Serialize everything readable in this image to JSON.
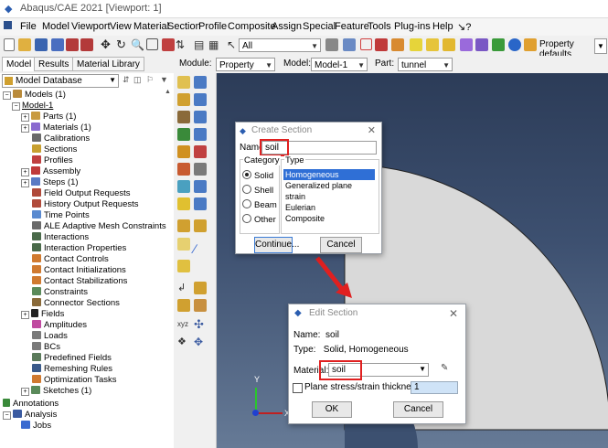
{
  "window": {
    "title": "Abaqus/CAE 2021 [Viewport: 1]"
  },
  "menu": [
    "File",
    "Model",
    "Viewport",
    "View",
    "Material",
    "Section",
    "Profile",
    "Composite",
    "Assign",
    "Special",
    "Feature",
    "Tools",
    "Plug-ins",
    "Help",
    "↘?"
  ],
  "toolbar": {
    "select_filter": "All",
    "property_defaults": "Property defaults"
  },
  "tabs": [
    "Model",
    "Results",
    "Material Library"
  ],
  "context": {
    "module_label": "Module:",
    "module": "Property",
    "model_label": "Model:",
    "model": "Model-1",
    "part_label": "Part:",
    "part": "tunnel"
  },
  "tree": {
    "header": "Model Database",
    "items": [
      "Models (1)",
      "Model-1",
      "Parts (1)",
      "Materials (1)",
      "Calibrations",
      "Sections",
      "Profiles",
      "Assembly",
      "Steps (1)",
      "Field Output Requests",
      "History Output Requests",
      "Time Points",
      "ALE Adaptive Mesh Constraints",
      "Interactions",
      "Interaction Properties",
      "Contact Controls",
      "Contact Initializations",
      "Contact Stabilizations",
      "Constraints",
      "Connector Sections",
      "Fields",
      "Amplitudes",
      "Loads",
      "BCs",
      "Predefined Fields",
      "Remeshing Rules",
      "Optimization Tasks",
      "Sketches (1)",
      "Annotations",
      "Analysis",
      "Jobs"
    ]
  },
  "create_section": {
    "title": "Create Section",
    "name_label": "Name:",
    "name_value": "soil",
    "category_label": "Category",
    "categories": [
      "Solid",
      "Shell",
      "Beam",
      "Other"
    ],
    "type_label": "Type",
    "types": [
      "Homogeneous",
      "Generalized plane strain",
      "Eulerian",
      "Composite"
    ],
    "continue": "Continue...",
    "cancel": "Cancel"
  },
  "edit_section": {
    "title": "Edit Section",
    "name_line": "Name:  soil",
    "type_line": "Type:   Solid, Homogeneous",
    "material_label": "Material:",
    "material_value": "soil",
    "plane_label": "Plane stress/strain thickness:",
    "plane_value": "1",
    "ok": "OK",
    "cancel": "Cancel"
  },
  "triad": {
    "x": "X",
    "y": "Y"
  },
  "colors": {
    "accent": "#3a7bd5",
    "highlight": "#e02020",
    "viewport_top": "#2c3c58",
    "part": "#d9d9d9"
  }
}
